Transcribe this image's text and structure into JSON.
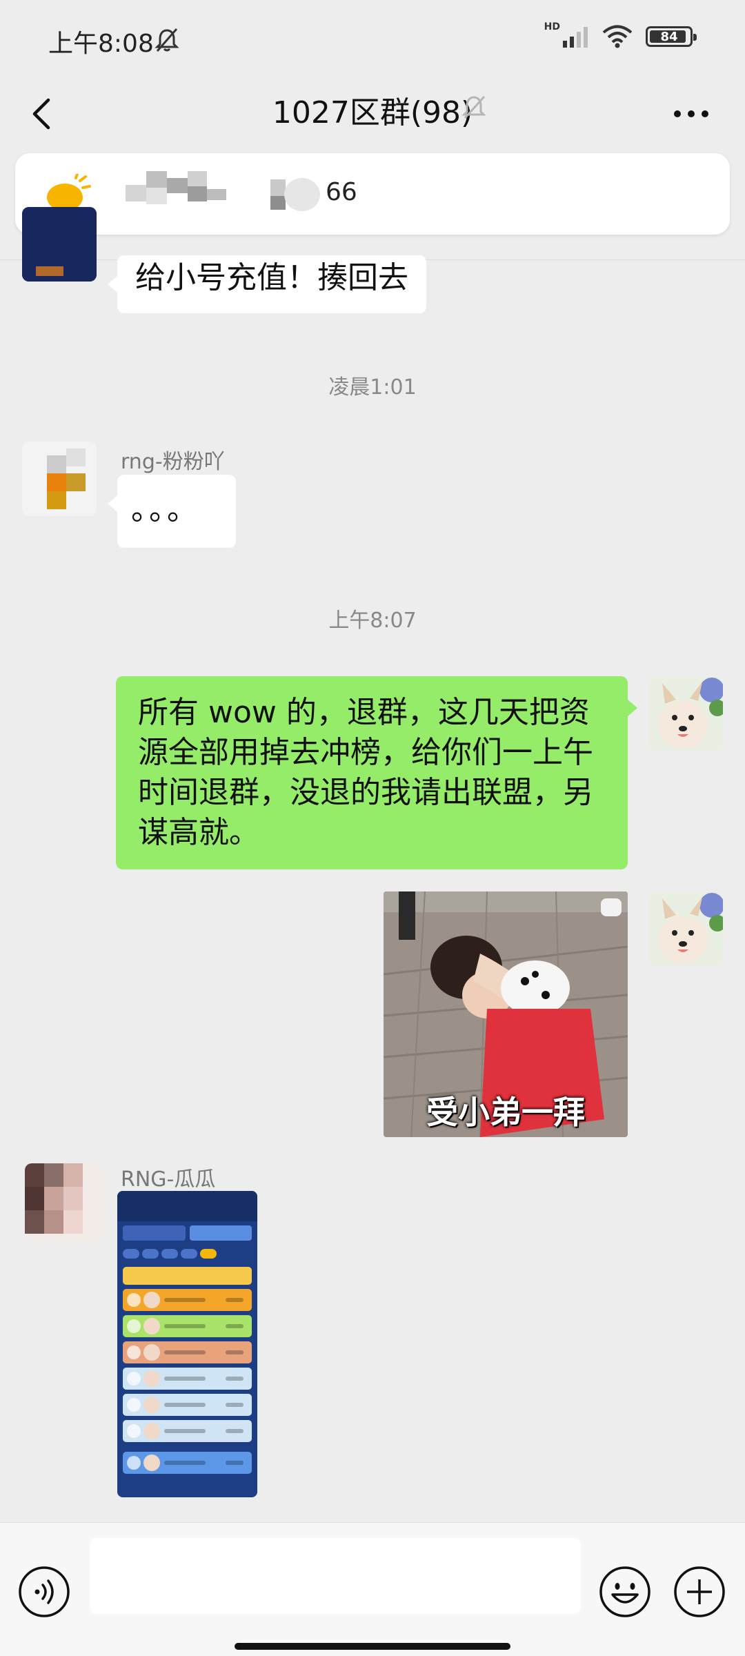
{
  "status_bar": {
    "time": "上午8:08",
    "network_label": "HD",
    "battery": "84",
    "battery_level": 0.84
  },
  "header": {
    "title": "1027区群(98)"
  },
  "pinned": {
    "text": "66"
  },
  "messages": {
    "msg1_text": "给小号充值！揍回去",
    "time1": "凌晨1:01",
    "msg2_sender": "rng-粉粉吖",
    "msg2_text": "。。。",
    "time2": "上午8:07",
    "msg3_text": "所有 wow 的，退群，这几天把资源全部用掉去冲榜，给你们一上午时间退群，没退的我请出联盟，另谋高就。",
    "sticker_caption": "受小弟一拜",
    "msg5_sender": "RNG-瓜瓜"
  },
  "colors": {
    "background": "#ededed",
    "bubble_self": "#95ec69",
    "bubble_other": "#ffffff",
    "input_bar": "#f7f7f7"
  },
  "icons": [
    "bell-off-icon",
    "signal-icon",
    "wifi-icon",
    "battery-icon",
    "back-icon",
    "mute-icon",
    "more-icon",
    "voice-icon",
    "emoji-icon",
    "plus-icon"
  ]
}
